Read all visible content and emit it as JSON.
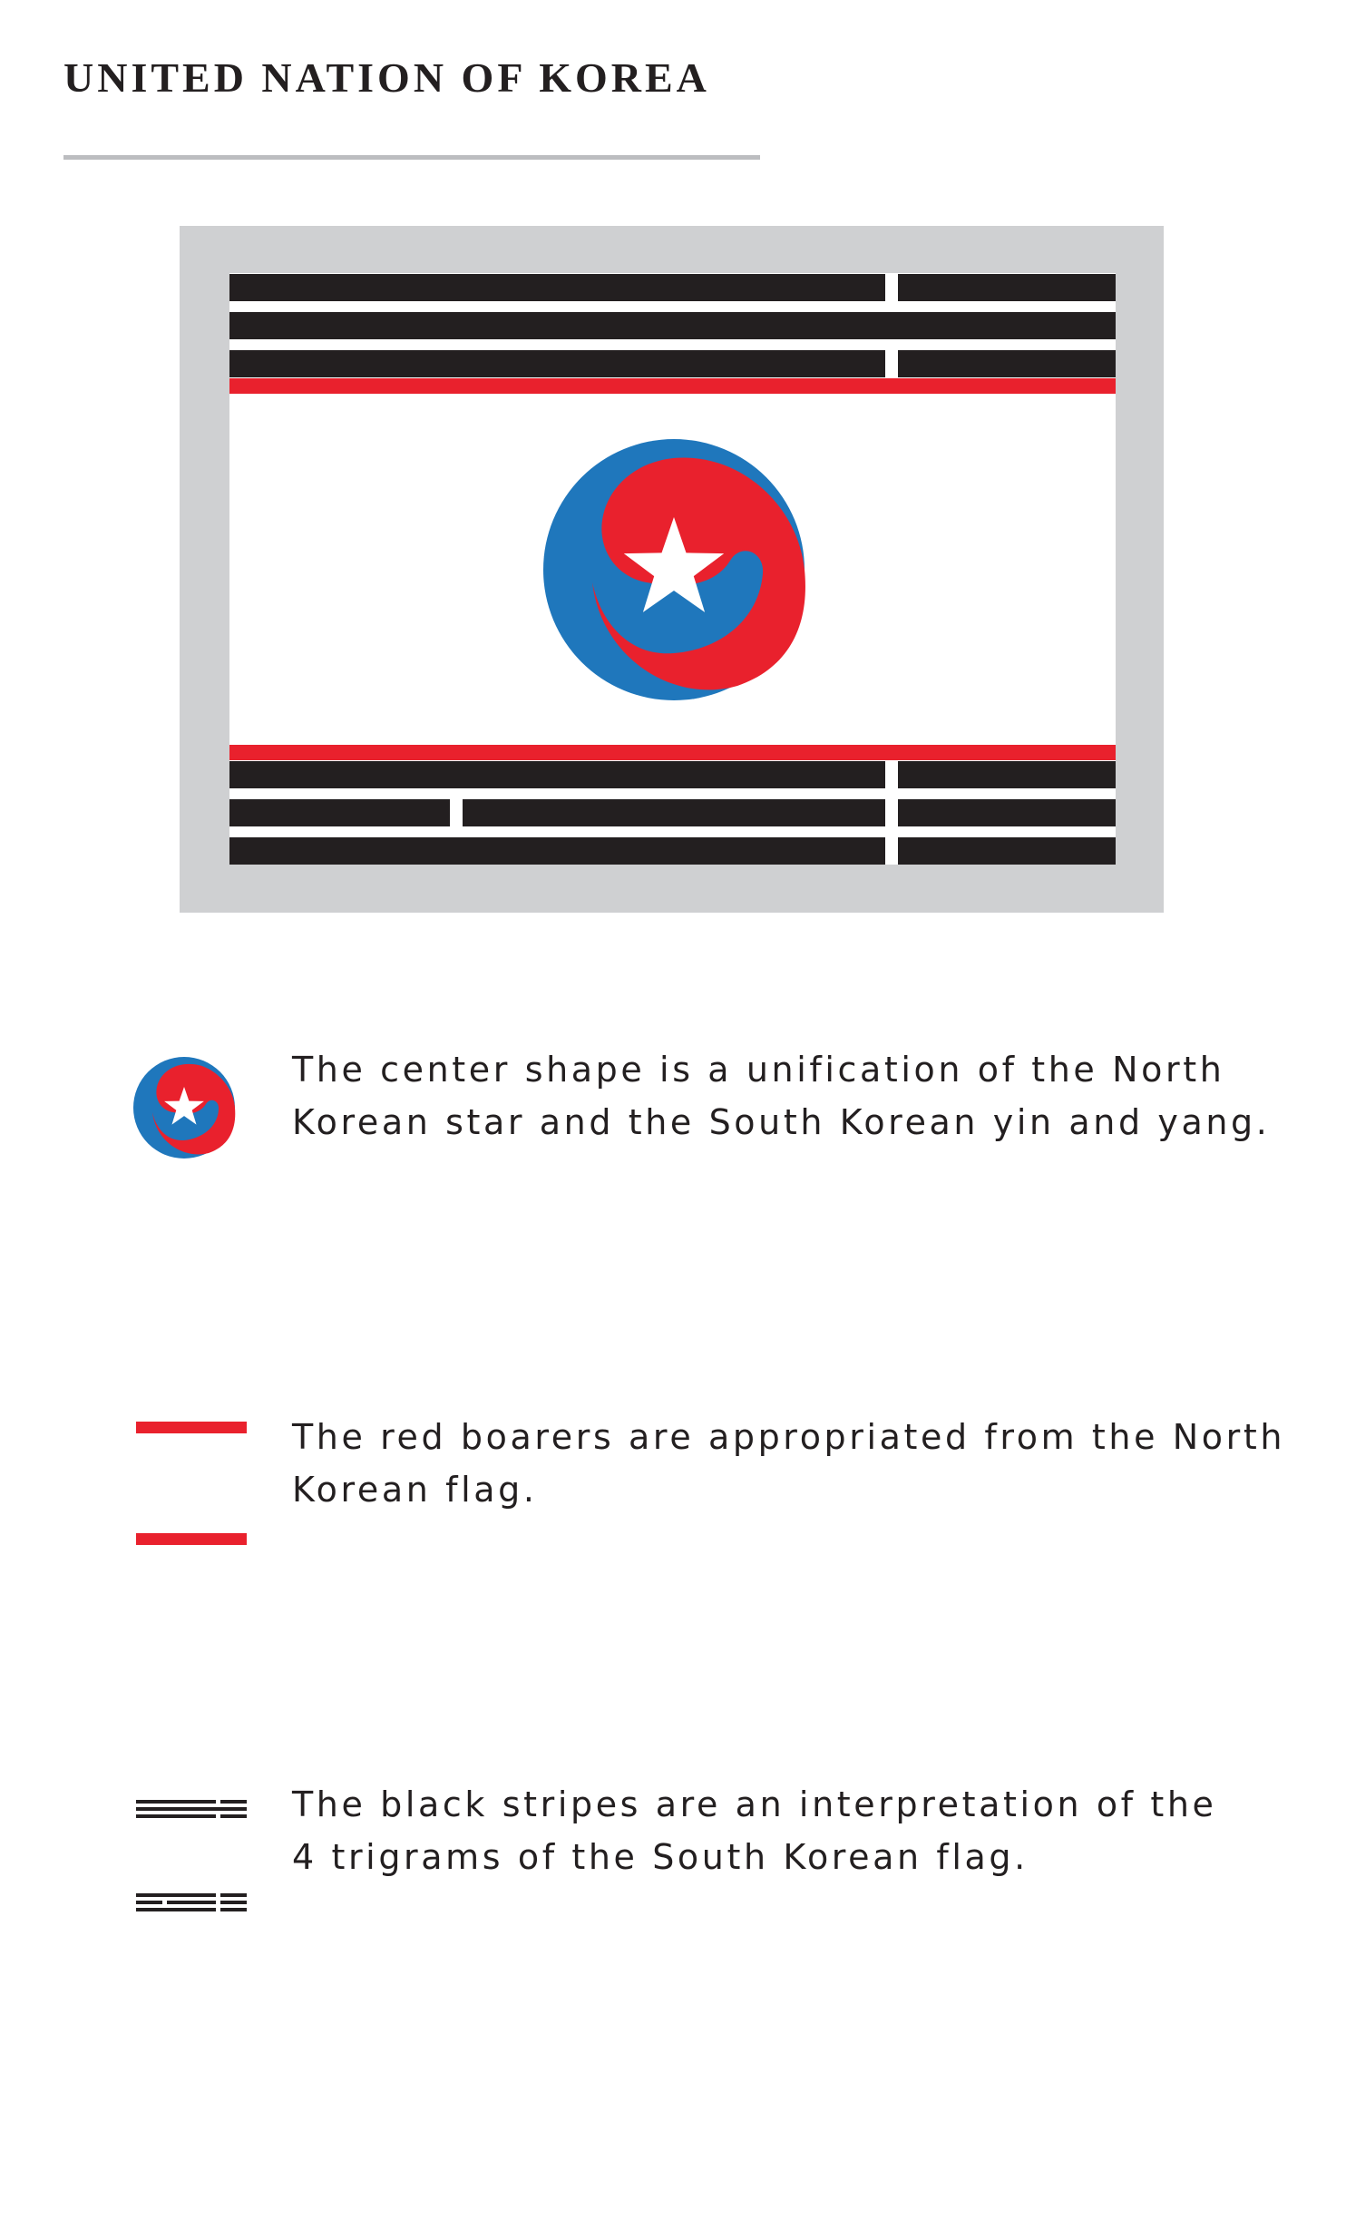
{
  "header": {
    "title": "UNITED NATION OF KOREA"
  },
  "colors": {
    "frame": "#cfd0d2",
    "stripe_black": "#231f20",
    "border_red": "#e9212d",
    "field_white": "#ffffff",
    "emblem_blue": "#1f77bc",
    "emblem_red": "#e9212d",
    "star_white": "#ffffff",
    "rule_gray": "#bcbdc0"
  },
  "notes": [
    {
      "icon": "unified-emblem-icon",
      "lines": [
        "The center shape is a unification of the North",
        "Korean star and the South Korean yin and yang."
      ]
    },
    {
      "icon": "red-borders-icon",
      "lines": [
        "The red boarers are appropriated from the North",
        "Korean flag."
      ]
    },
    {
      "icon": "trigram-stripes-icon",
      "lines": [
        "The black stripes are an interpretation of the",
        "4 trigrams of the South Korean flag."
      ]
    }
  ]
}
